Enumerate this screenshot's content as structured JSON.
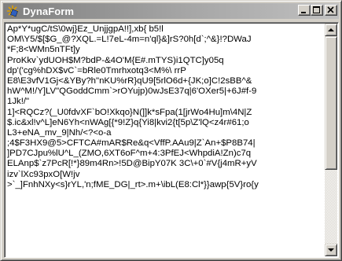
{
  "window": {
    "title": "DynaForm",
    "minimize_label": "_",
    "maximize_label": "□",
    "close_label": "×"
  },
  "textarea": {
    "lines": [
      "Ap*Y*ugC/tS\\0wj}Ez_UnjjgpA!!],xb{ b5!l",
      "OM\\Y5/$[$G_@?XQL.=L!7eL-4m=n'ql}&]rS?0h[d`;^&}!?DWaJ",
      "*F;8<WMn5nTFt]y",
      "ProKkv`ydUOH$M?bdP-&4O'M{E#.mTYS)i1QTC]y05q",
      "dp'('cg%hDX$vC`=bRle0Tmrhxotq3<M%\\ rrP",
      "E8\\E3vfV1Gj<&YBy?h\"nKU%rR}qU9[5rlO6d+{JK;o]C!2sBB^&",
      "hW^M!/Y]LV\"QGoddCmm`>rOYujp)0wJsE37q|6'OXer5|+6J#f-9",
      "1Jk!/\"",
      "1]<RQCz?(_U0fdvXF`bO!Xkqo}N(]]k*sFpa(1[jrWo4Hu]m\\4N|Z",
      "$.ic&xl!v^L]eN6Yh<nWAg[{*9!Z}q{Yi8|kvi2{t[5p\\Z'lQ<z4r#61;o",
      "L3+eNA_mv_9|Nh/<?<o-a",
      ";4$F3HX9@5>CFTCA#mAR$Re&q<VffP.AAu9|Z`An+$P8B74|",
      "]PD7CJpu%lU^L_(ZMO,6XT6oF^m+4:3PfEJ<WhpdiA!Zn)c7q",
      "ELAnp$`z7PcR[!*}89m4Rn>!5D@BipY07K 3C\\+0`#V{j4mR+yV",
      "izv`lXc93pxO[W!jv",
      ">`_]FnhNXy<s}rYL,'n;fME_DG|_rt>.m+\\ibL(E8:Cl*}}awp{5V}ro{y"
    ]
  }
}
